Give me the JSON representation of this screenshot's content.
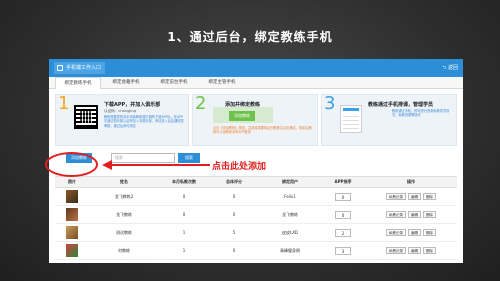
{
  "slide": {
    "title": "1、通过后台，绑定教练手机"
  },
  "window": {
    "app_button": "手机端工作入口",
    "back_label": "返回",
    "tabs": [
      "绑定教练手机",
      "绑定会籍手机",
      "绑定前台手机",
      "绑定主管手机"
    ]
  },
  "steps": [
    {
      "num": "1",
      "title": "下载APP，并加入俱乐部",
      "code": "认证码：changjing",
      "desc": "教练需要您的本手机版教练端已拥有下载APP后，在APP中通过俱乐部认证码加入本俱乐部，申请进入后会通知您审核，通过后即可绑定"
    },
    {
      "num": "2",
      "title": "添加并绑定教练",
      "button": "添加教练",
      "desc": "点击【添加教练】按钮，并选择需要绑定的教练并点击确定，绑定后教练可以用教练手机APP登录"
    },
    {
      "num": "3",
      "title": "教练通过手机排课，管理学员",
      "desc": "教练通过手机，即可进行查看私教学员情况，私教排课等操作"
    }
  ],
  "toolbar": {
    "add_button": "添加教练",
    "search_placeholder": "搜索",
    "search_button": "搜索"
  },
  "callout": "点击此处添加",
  "table": {
    "headers": [
      "照片",
      "姓名",
      "本月私教次数",
      "总体评分",
      "绑定用户",
      "APP排序",
      "操作"
    ],
    "rows": [
      {
        "name": "龙飞教练2",
        "count": "0",
        "score": "0",
        "user": "Felix1",
        "order": "0"
      },
      {
        "name": "龙飞教练",
        "count": "0",
        "score": "0",
        "user": "龙飞教练",
        "order": "0"
      },
      {
        "name": "测试教练",
        "count": "1",
        "score": "5",
        "user": "皮皮LXD",
        "order": "2"
      },
      {
        "name": "刘教练",
        "count": "1",
        "score": "0",
        "user": "青峰健身俱",
        "order": "3"
      }
    ],
    "actions": [
      "私教记录",
      "编辑",
      "删除"
    ]
  },
  "colors": {
    "accent": "#2d8ed8",
    "highlight": "#e02020",
    "step1": "#f5a623",
    "step2": "#6cc24a",
    "step3": "#3ca1e8"
  }
}
